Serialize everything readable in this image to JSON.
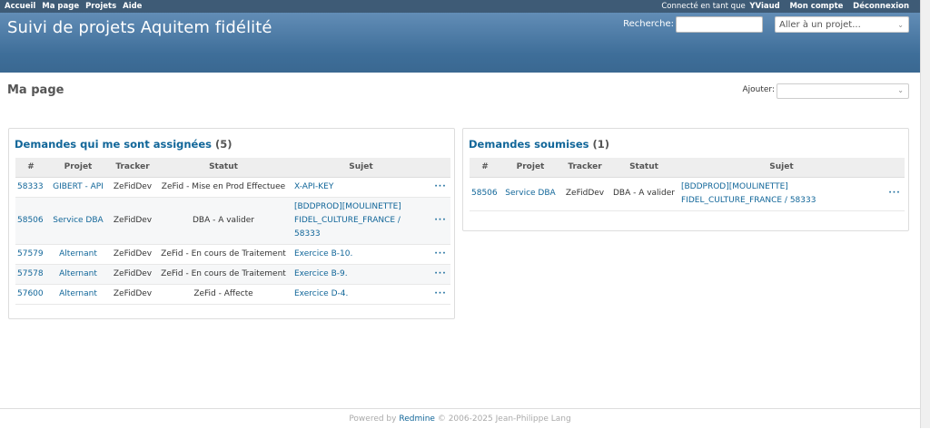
{
  "top_menu": {
    "left_items": [
      "Accueil",
      "Ma page",
      "Projets",
      "Aide"
    ],
    "logged_in_prefix": "Connecté en tant que",
    "username": "YViaud",
    "my_account": "Mon compte",
    "logout": "Déconnexion"
  },
  "header": {
    "title": "Suivi de projets Aquitem fidélité",
    "search_label": "Recherche:",
    "search_value": "",
    "jump_placeholder": "Aller à un projet..."
  },
  "page": {
    "title": "Ma page",
    "add_label": "Ajouter:",
    "add_value": ""
  },
  "assigned": {
    "title": "Demandes qui me sont assignées",
    "count": "(5)",
    "columns": [
      "#",
      "Projet",
      "Tracker",
      "Statut",
      "Sujet"
    ],
    "rows": [
      {
        "id": "58333",
        "project": "GIBERT - API",
        "tracker": "ZeFidDev",
        "status": "ZeFid - Mise en Prod Effectuee",
        "subject": "X-API-KEY"
      },
      {
        "id": "58506",
        "project": "Service DBA",
        "tracker": "ZeFidDev",
        "status": "DBA - A valider",
        "subject": "[BDDPROD][MOULINETTE] FIDEL_CULTURE_FRANCE / 58333"
      },
      {
        "id": "57579",
        "project": "Alternant",
        "tracker": "ZeFidDev",
        "status": "ZeFid - En cours de Traitement",
        "subject": "Exercice B-10."
      },
      {
        "id": "57578",
        "project": "Alternant",
        "tracker": "ZeFidDev",
        "status": "ZeFid - En cours de Traitement",
        "subject": "Exercice B-9."
      },
      {
        "id": "57600",
        "project": "Alternant",
        "tracker": "ZeFidDev",
        "status": "ZeFid - Affecte",
        "subject": "Exercice D-4."
      }
    ]
  },
  "submitted": {
    "title": "Demandes soumises",
    "count": "(1)",
    "columns": [
      "#",
      "Projet",
      "Tracker",
      "Statut",
      "Sujet"
    ],
    "rows": [
      {
        "id": "58506",
        "project": "Service DBA",
        "tracker": "ZeFidDev",
        "status": "DBA - A valider",
        "subject": "[BDDPROD][MOULINETTE] FIDEL_CULTURE_FRANCE / 58333"
      }
    ]
  },
  "row_action_label": "···",
  "footer": {
    "prefix": "Powered by",
    "link": "Redmine",
    "suffix": "© 2006-2025 Jean-Philippe Lang"
  }
}
